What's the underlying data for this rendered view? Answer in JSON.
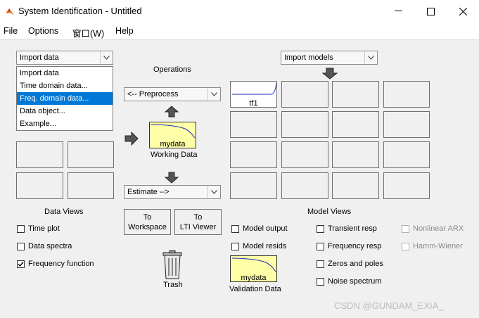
{
  "window": {
    "title": "System Identification - Untitled"
  },
  "menu": [
    "File",
    "Options",
    "窗口(W)",
    "Help"
  ],
  "import_data": {
    "label": "Import data",
    "options": [
      "Import data",
      "Time domain data...",
      "Freq. domain data...",
      "Data object...",
      "Example..."
    ],
    "highlighted_index": 2
  },
  "operations": {
    "title": "Operations",
    "preprocess": "<-- Preprocess",
    "working_data_name": "mydata",
    "working_data_label": "Working Data",
    "estimate": "Estimate -->",
    "to_workspace": [
      "To",
      "Workspace"
    ],
    "to_lti": [
      "To",
      "LTI Viewer"
    ]
  },
  "data_views": {
    "title": "Data Views",
    "items": [
      {
        "label": "Time plot",
        "checked": false
      },
      {
        "label": "Data spectra",
        "checked": false
      },
      {
        "label": "Frequency function",
        "checked": true
      }
    ]
  },
  "trash": {
    "label": "Trash"
  },
  "import_models": {
    "label": "Import models",
    "model_name": "tf1"
  },
  "model_views": {
    "title": "Model Views",
    "col1": [
      {
        "label": "Model output",
        "checked": false
      },
      {
        "label": "Model resids",
        "checked": false
      }
    ],
    "col2": [
      {
        "label": "Transient resp",
        "checked": false
      },
      {
        "label": "Frequency resp",
        "checked": false
      },
      {
        "label": "Zeros and poles",
        "checked": false
      },
      {
        "label": "Noise spectrum",
        "checked": false
      }
    ],
    "col3": [
      {
        "label": "Nonlinear ARX",
        "checked": false,
        "enabled": false
      },
      {
        "label": "Hamm-Wiener",
        "checked": false,
        "enabled": false
      }
    ]
  },
  "validation": {
    "data_name": "mydata",
    "label": "Validation Data"
  },
  "watermark": "CSDN @GUNDAM_EXIA_",
  "colors": {
    "curve": "#1f2fbf",
    "yellow": "#ffffa8",
    "selection": "#0078d7"
  }
}
